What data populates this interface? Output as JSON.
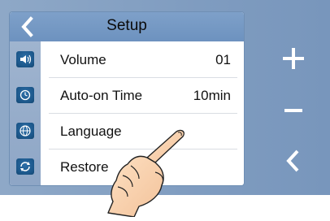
{
  "screen": {
    "title": "Setup"
  },
  "menu": {
    "items": [
      {
        "label": "Volume",
        "value": "01",
        "icon": "speaker-icon"
      },
      {
        "label": "Auto-on Time",
        "value": "10min",
        "icon": "timer-icon"
      },
      {
        "label": "Language",
        "value": "",
        "icon": "globe-icon"
      },
      {
        "label": "Restore",
        "value": "",
        "icon": "restore-icon"
      }
    ]
  },
  "side_buttons": [
    "plus-icon",
    "minus-icon",
    "back-arrow-icon"
  ],
  "colors": {
    "panel": "#7f9cc0",
    "titlebar": "#6d92bf",
    "icon": "#1b5689"
  }
}
